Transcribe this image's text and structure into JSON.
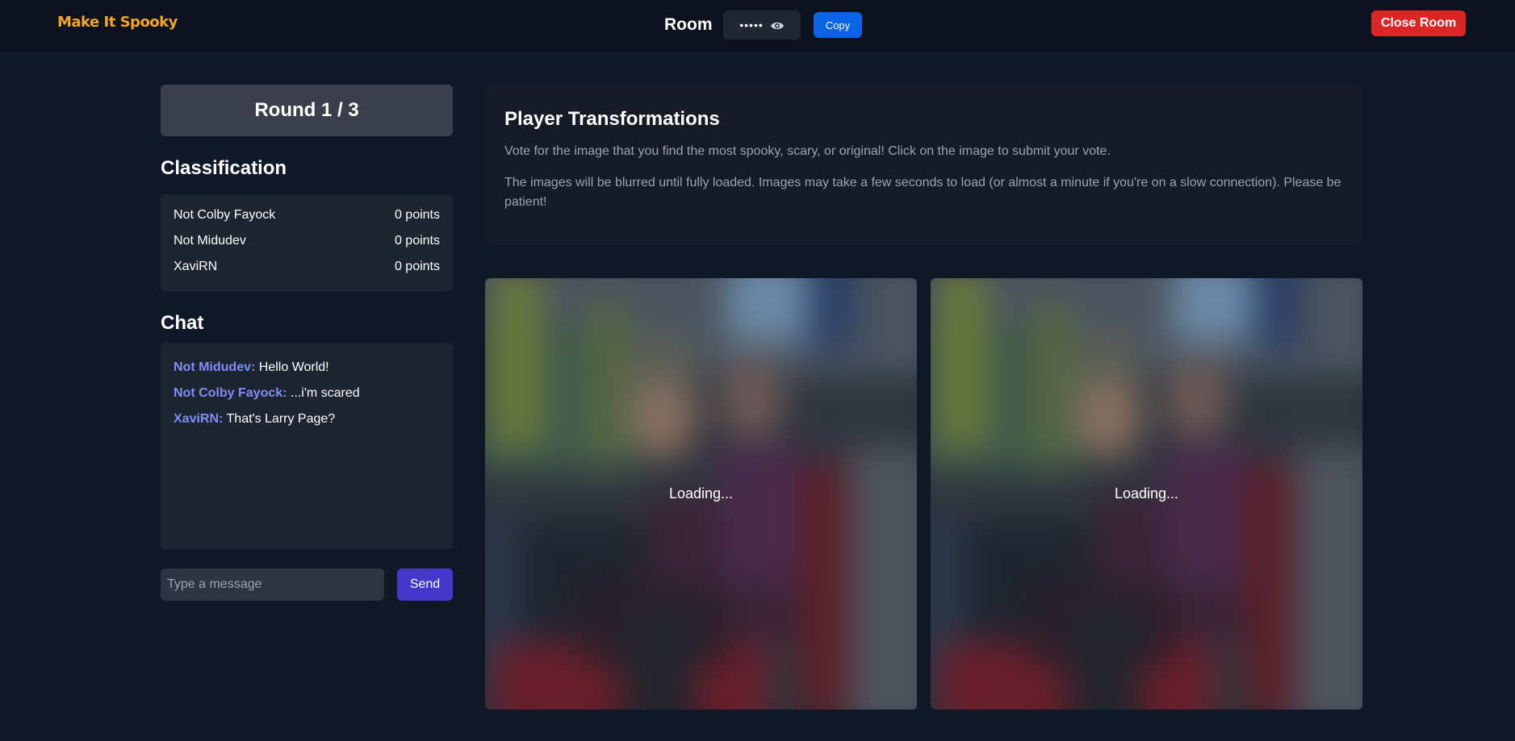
{
  "header": {
    "logo": "Make It Spooky",
    "room_label": "Room",
    "room_code_masked": "•••••",
    "copy_label": "Copy",
    "close_label": "Close Room"
  },
  "round": {
    "label": "Round 1 / 3"
  },
  "classification": {
    "title": "Classification",
    "players": [
      {
        "name": "Not Colby Fayock",
        "points": "0 points"
      },
      {
        "name": "Not Midudev",
        "points": "0 points"
      },
      {
        "name": "XaviRN",
        "points": "0 points"
      }
    ]
  },
  "chat": {
    "title": "Chat",
    "messages": [
      {
        "author": "Not Midudev:",
        "text": "Hello World!"
      },
      {
        "author": "Not Colby Fayock:",
        "text": "...i'm scared"
      },
      {
        "author": "XaviRN:",
        "text": "That's Larry Page?"
      }
    ],
    "input_placeholder": "Type a message",
    "send_label": "Send"
  },
  "transformations": {
    "title": "Player Transformations",
    "instructions": "Vote for the image that you find the most spooky, scary, or original! Click on the image to submit your vote.",
    "note": "The images will be blurred until fully loaded. Images may take a few seconds to load (or almost a minute if you're on a slow connection). Please be patient!",
    "images": [
      {
        "status": "Loading..."
      },
      {
        "status": "Loading..."
      }
    ]
  },
  "colors": {
    "background": "#111827",
    "logo": "#f5a524",
    "copy_button": "#0b63e6",
    "close_button": "#dc2626",
    "send_button": "#4338ca",
    "chat_author": "#818cf8"
  }
}
